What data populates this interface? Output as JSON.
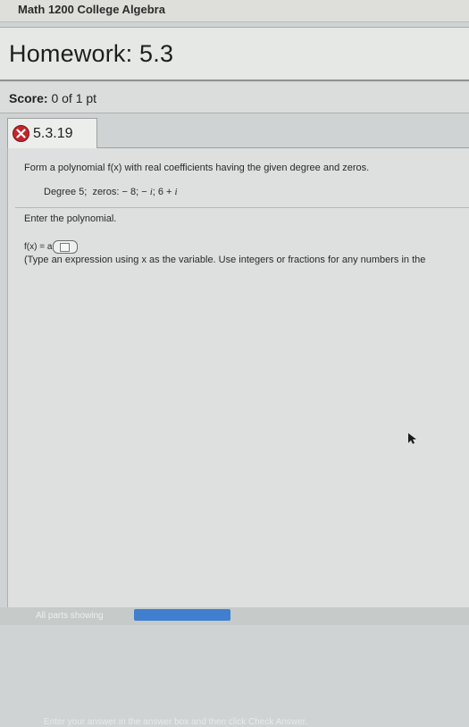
{
  "course": {
    "title": "Math 1200 College Algebra"
  },
  "homework": {
    "title": "Homework: 5.3"
  },
  "score": {
    "label": "Score:",
    "value": "0 of 1 pt"
  },
  "question": {
    "number": "5.3.19",
    "status_icon": "x-circle-icon",
    "status_color": "#c2262d",
    "prompt": "Form a polynomial f(x) with real coefficients having the given degree and zeros.",
    "degree_text": "Degree 5;",
    "zeros_label": "zeros:",
    "zero_1": "− 8;",
    "zero_2_prefix": "−",
    "imag_unit": "i",
    "zero_3_prefix": "; 6 +",
    "enter_text": "Enter the polynomial.",
    "fx_label": "f(x) = a",
    "hint": "(Type an expression using x as the variable. Use integers or fractions for any numbers in the"
  },
  "footer": {
    "hint": "Enter your answer in the answer box and then click Check Answer.",
    "parts": "All parts showing"
  },
  "colors": {
    "accent": "#3f7fce",
    "background": "#dde0df"
  }
}
